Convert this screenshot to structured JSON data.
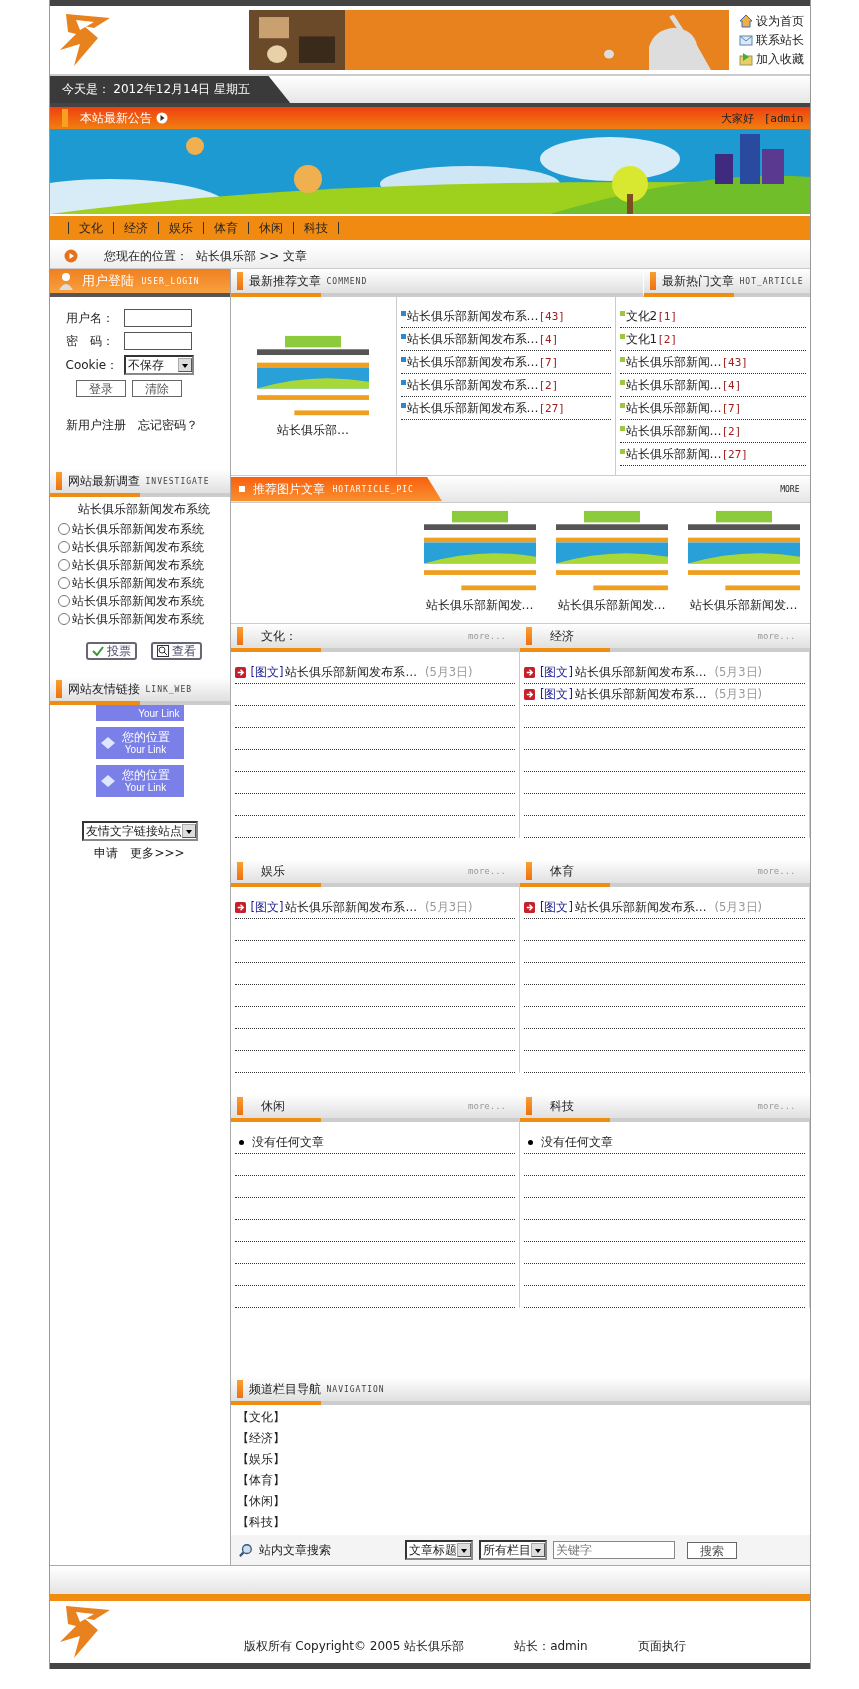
{
  "header": {
    "links": [
      {
        "label": "设为首页",
        "kind": "home"
      },
      {
        "label": "联系站长",
        "kind": "mail"
      },
      {
        "label": "加入收藏",
        "kind": "bookmark"
      }
    ]
  },
  "date_bar": {
    "label": "今天是：",
    "date": "2012年12月14日 星期五"
  },
  "notice": {
    "title": "本站最新公告",
    "marquee": [
      "大家好",
      "[admin"
    ]
  },
  "nav": [
    "文化",
    "经济",
    "娱乐",
    "体育",
    "休闲",
    "科技"
  ],
  "breadcrumb": {
    "label": "您现在的位置：",
    "path": "站长俱乐部 >> 文章"
  },
  "login": {
    "title": "用户登陆",
    "subtitle": "USER_LOGIN",
    "fields": [
      "用户名：",
      "密　码："
    ],
    "cookie": {
      "label": "Cookie：",
      "value": "不保存"
    },
    "buttons": [
      "登录",
      "清除"
    ],
    "links": [
      "新用户注册",
      "忘记密码？"
    ]
  },
  "poll": {
    "title": "网站最新调查",
    "subtitle": "INVESTIGATE",
    "question": "站长俱乐部新闻发布系统",
    "options": [
      {
        "label": "站长俱乐部新闻发布系统",
        "selected": false
      },
      {
        "label": "站长俱乐部新闻发布系统",
        "selected": false
      },
      {
        "label": "站长俱乐部新闻发布系统",
        "selected": false
      },
      {
        "label": "站长俱乐部新闻发布系统",
        "selected": false
      },
      {
        "label": "站长俱乐部新闻发布系统",
        "selected": false
      },
      {
        "label": "站长俱乐部新闻发布系统",
        "selected": false
      }
    ],
    "buttons": [
      {
        "label": "投票",
        "kind": "vote"
      },
      {
        "label": "查看",
        "kind": "view"
      }
    ]
  },
  "links": {
    "title": "网站友情链接",
    "subtitle": "LINK_WEB",
    "banners": [
      {
        "sub": "Your Link"
      },
      {
        "title": "您的位置",
        "sub": "Your Link"
      },
      {
        "title": "您的位置",
        "sub": "Your Link"
      }
    ],
    "select": "友情文字链接站点",
    "actions": [
      "申请",
      "更多>>>"
    ]
  },
  "recommend": {
    "title": "最新推荐文章",
    "subtitle": "COMMEND",
    "image_caption": "站长俱乐部…",
    "items": [
      {
        "title": "站长俱乐部新闻发布系…",
        "count": "[43]"
      },
      {
        "title": "站长俱乐部新闻发布系…",
        "count": "[4]"
      },
      {
        "title": "站长俱乐部新闻发布系…",
        "count": "[7]"
      },
      {
        "title": "站长俱乐部新闻发布系…",
        "count": "[2]"
      },
      {
        "title": "站长俱乐部新闻发布系…",
        "count": "[27]"
      }
    ]
  },
  "hot": {
    "title": "最新热门文章",
    "subtitle": "HOT_ARTICLE",
    "items": [
      {
        "title": "文化2",
        "count": "[1]"
      },
      {
        "title": "文化1",
        "count": "[2]"
      },
      {
        "title": "站长俱乐部新闻…",
        "count": "[43]"
      },
      {
        "title": "站长俱乐部新闻…",
        "count": "[4]"
      },
      {
        "title": "站长俱乐部新闻…",
        "count": "[7]"
      },
      {
        "title": "站长俱乐部新闻…",
        "count": "[2]"
      },
      {
        "title": "站长俱乐部新闻…",
        "count": "[27]"
      }
    ]
  },
  "pictures": {
    "title": "推荐图片文章",
    "subtitle": "HOTARTICLE_PIC",
    "more": "MORE",
    "captions": [
      "站长俱乐部新闻发…",
      "站长俱乐部新闻发…",
      "站长俱乐部新闻发…"
    ]
  },
  "categories": [
    {
      "title": "文化：",
      "more": "more...",
      "items": [
        {
          "kind": "article",
          "tag": "[图文]",
          "title": "站长俱乐部新闻发布系…",
          "date": "(5月3日)"
        }
      ]
    },
    {
      "title": "经济",
      "more": "more...",
      "items": [
        {
          "kind": "article",
          "tag": "[图文]",
          "title": "站长俱乐部新闻发布系…",
          "date": "(5月3日)"
        },
        {
          "kind": "article",
          "tag": "[图文]",
          "title": "站长俱乐部新闻发布系…",
          "date": "(5月3日)"
        }
      ]
    },
    {
      "title": "娱乐",
      "more": "more...",
      "items": [
        {
          "kind": "article",
          "tag": "[图文]",
          "title": "站长俱乐部新闻发布系…",
          "date": "(5月3日)"
        }
      ]
    },
    {
      "title": "体育",
      "more": "more...",
      "items": [
        {
          "kind": "article",
          "tag": "[图文]",
          "title": "站长俱乐部新闻发布系…",
          "date": "(5月3日)"
        }
      ]
    },
    {
      "title": "休闲",
      "more": "more...",
      "items": [
        {
          "kind": "empty",
          "title": "没有任何文章"
        }
      ]
    },
    {
      "title": "科技",
      "more": "more...",
      "items": [
        {
          "kind": "empty",
          "title": "没有任何文章"
        }
      ]
    }
  ],
  "navigation": {
    "title": "频道栏目导航",
    "subtitle": "NAVIGATION",
    "items": [
      "【文化】",
      "【经济】",
      "【娱乐】",
      "【体育】",
      "【休闲】",
      "【科技】"
    ]
  },
  "search": {
    "label": "站内文章搜索",
    "field": "文章标题",
    "scope": "所有栏目",
    "placeholder": "关键字",
    "button": "搜索"
  },
  "footer": {
    "copyright": "版权所有 Copyright© 2005 站长俱乐部",
    "admin": "站长：admin",
    "runtime": "页面执行"
  }
}
